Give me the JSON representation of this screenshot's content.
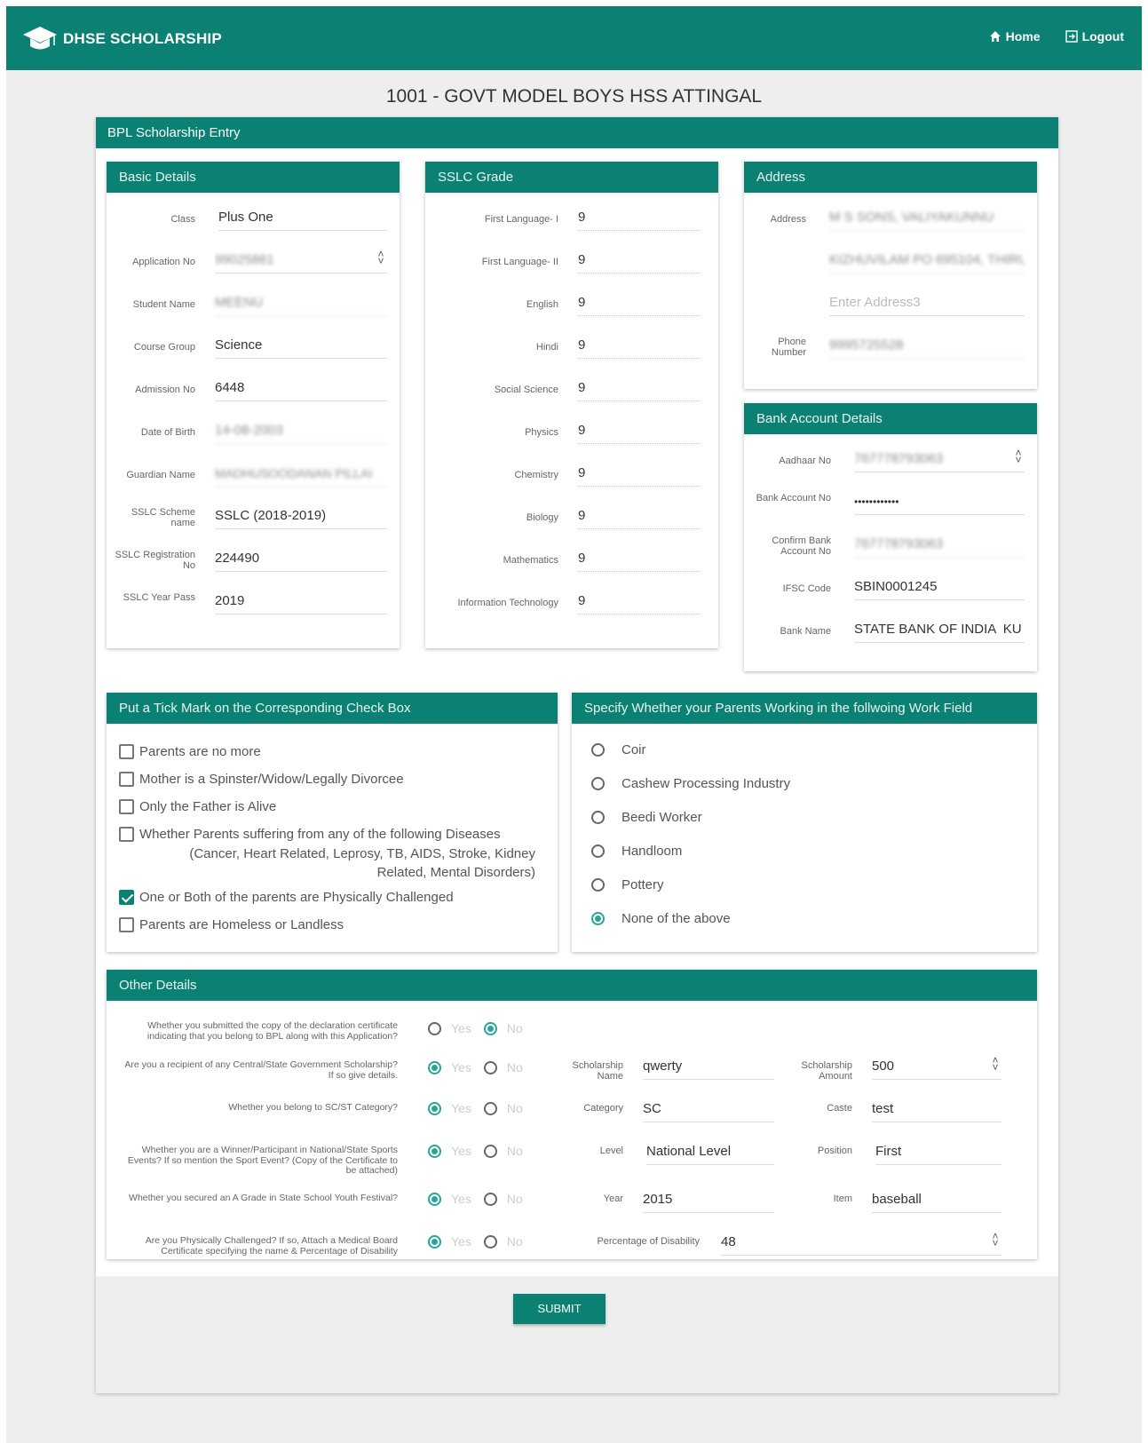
{
  "navbar": {
    "brand": "DHSE SCHOLARSHIP",
    "home_label": "Home",
    "logout_label": "Logout"
  },
  "school_title": "1001 - GOVT MODEL BOYS HSS ATTINGAL",
  "form_title": "BPL Scholarship Entry",
  "basic_details": {
    "title": "Basic Details",
    "fields": [
      {
        "label": "Class",
        "value": "Plus One"
      },
      {
        "label": "Application No",
        "value": "99025861"
      },
      {
        "label": "Student Name",
        "value": "MEENU"
      },
      {
        "label": "Course Group",
        "value": "Science"
      },
      {
        "label": "Admission No",
        "value": "6448"
      },
      {
        "label": "Date of Birth",
        "value": "14-08-2003"
      },
      {
        "label": "Guardian Name",
        "value": "MADHUSOODANAN PILLAI"
      },
      {
        "label": "SSLC Scheme name",
        "value": "SSLC (2018-2019)"
      },
      {
        "label": "SSLC Registration No",
        "value": "224490"
      },
      {
        "label": "SSLC Year Pass",
        "value": "2019"
      }
    ]
  },
  "sslc_grade": {
    "title": "SSLC Grade",
    "fields": [
      {
        "label": "First Language- I",
        "value": "9"
      },
      {
        "label": "First Language- II",
        "value": "9"
      },
      {
        "label": "English",
        "value": "9"
      },
      {
        "label": "Hindi",
        "value": "9"
      },
      {
        "label": "Social Science",
        "value": "9"
      },
      {
        "label": "Physics",
        "value": "9"
      },
      {
        "label": "Chemistry",
        "value": "9"
      },
      {
        "label": "Biology",
        "value": "9"
      },
      {
        "label": "Mathematics",
        "value": "9"
      },
      {
        "label": "Information Technology",
        "value": "9"
      }
    ]
  },
  "address": {
    "title": "Address",
    "address_label": "Address",
    "address1": "M S SONS, VALIYAKUNNU",
    "address2": "KIZHUVILAM PO 695104, THIRU",
    "address3_placeholder": "Enter Address3",
    "phone_label": "Phone Number",
    "phone": "9995725528"
  },
  "bank": {
    "title": "Bank Account Details",
    "fields": [
      {
        "label": "Aadhaar No",
        "value": "767778793063"
      },
      {
        "label": "Bank Account No",
        "value": "••••••••••••"
      },
      {
        "label": "Confirm Bank Account No",
        "value": "767778793063"
      },
      {
        "label": "IFSC Code",
        "value": "SBIN0001245"
      },
      {
        "label": "Bank Name",
        "value": "STATE BANK OF INDIA  KU"
      }
    ]
  },
  "checkboxes": {
    "title": "Put a Tick Mark on the Corresponding Check Box",
    "items": [
      {
        "label": "Parents are no more",
        "checked": false
      },
      {
        "label": "Mother is a Spinster/Widow/Legally Divorcee",
        "checked": false
      },
      {
        "label": "Only the Father is Alive",
        "checked": false
      },
      {
        "label": "Whether Parents suffering from any of the following Diseases",
        "sub": "(Cancer, Heart Related, Leprosy, TB, AIDS, Stroke, Kidney Related, Mental Disorders)",
        "checked": false
      },
      {
        "label": "One or Both of the parents are Physically Challenged",
        "checked": true
      },
      {
        "label": "Parents are Homeless or Landless",
        "checked": false
      }
    ]
  },
  "work_field": {
    "title": "Specify Whether your Parents Working in the follwoing Work Field",
    "options": [
      "Coir",
      "Cashew Processing Industry",
      "Beedi Worker",
      "Handloom",
      "Pottery",
      "None of the above"
    ],
    "selected": "None of the above"
  },
  "other_details": {
    "title": "Other Details",
    "yes_label": "Yes",
    "no_label": "No",
    "questions": [
      {
        "text": "Whether you submitted the copy of the declaration certificate indicating that you belong to BPL along with this Application?",
        "answer": "No"
      },
      {
        "text": "Are you a recipient of any Central/State Government Scholarship? If so give details.",
        "answer": "Yes"
      },
      {
        "text": "Whether you belong to SC/ST Category?",
        "answer": "Yes"
      },
      {
        "text": "Whether you are a Winner/Participant in National/State Sports Events? If so mention the Sport Event? (Copy of the Certificate to be attached)",
        "answer": "Yes"
      },
      {
        "text": "Whether you secured an A Grade in State School Youth Festival?",
        "answer": "Yes"
      },
      {
        "text": "Are you Physically Challenged? If so, Attach a Medical Board Certificate specifying the name & Percentage of Disability",
        "answer": "Yes"
      }
    ],
    "scholarship_name_label": "Scholarship Name",
    "scholarship_name": "qwerty",
    "scholarship_amount_label": "Scholarship Amount",
    "scholarship_amount": "500",
    "category_label": "Category",
    "category": "SC",
    "caste_label": "Caste",
    "caste": "test",
    "level_label": "Level",
    "level": "National Level",
    "position_label": "Position",
    "position": "First",
    "year_label": "Year",
    "year": "2015",
    "item_label": "Item",
    "item": "baseball",
    "disability_label": "Percentage of Disability",
    "disability": "48"
  },
  "submit_label": "SUBMIT"
}
